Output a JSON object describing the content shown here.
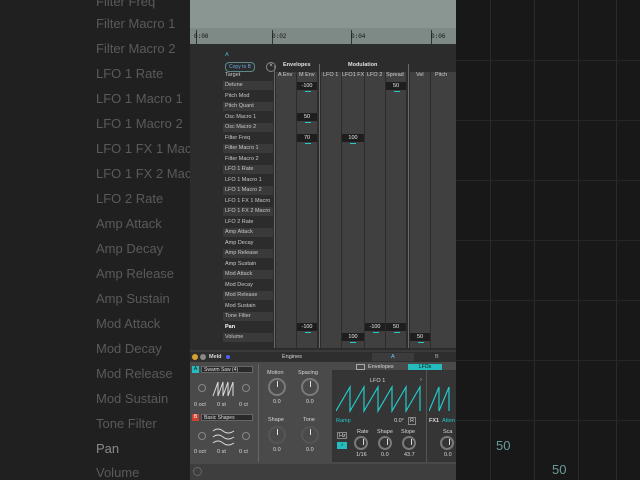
{
  "background_left": {
    "rows": [
      "Filter Freq",
      "Filter Macro 1",
      "Filter Macro 2",
      "LFO 1 Rate",
      "LFO 1 Macro 1",
      "LFO 1 Macro 2",
      "LFO 1 FX 1 Macro",
      "LFO 1 FX 2 Macro",
      "LFO 2 Rate",
      "Amp Attack",
      "Amp Decay",
      "Amp Release",
      "Amp Sustain",
      "Mod Attack",
      "Mod Decay",
      "Mod Release",
      "Mod Sustain",
      "Tone Filter",
      "Pan",
      "Volume"
    ]
  },
  "background_right": {
    "values": [
      "50",
      "50"
    ]
  },
  "timeline": {
    "ticks": [
      "0:00",
      "0:02",
      "0:04",
      "0:06"
    ]
  },
  "matrix": {
    "section": "A",
    "copy_button": "Copy to B",
    "close_icon": "×",
    "target_header": "Target",
    "group_envelopes": "Envelopes",
    "group_modulation": "Modulation",
    "columns": [
      "A Env",
      "M Env",
      "LFO 1",
      "LFO1 FX",
      "LFO 2",
      "Spread",
      "Vel",
      "Pitch"
    ],
    "targets": [
      "Detune",
      "Pitch Mod",
      "Pitch Quant",
      "Osc Macro 1",
      "Osc Macro 2",
      "Filter Freq",
      "Filter Macro 1",
      "Filter Macro 2",
      "LFO 1 Rate",
      "LFO 1 Macro 1",
      "LFO 1 Macro 2",
      "LFO 1 FX 1 Macro",
      "LFO 1 FX 2 Macro",
      "LFO 2 Rate",
      "Amp Attack",
      "Amp Decay",
      "Amp Release",
      "Amp Sustain",
      "Mod Attack",
      "Mod Decay",
      "Mod Release",
      "Mod Sustain",
      "Tone Filter",
      "Pan",
      "Volume"
    ],
    "values": {
      "detune_menv": "-100",
      "detune_spread": "50",
      "oscmacro1_menv": "50",
      "filterfreq_menv": "70",
      "filterfreq_lfo1": "100",
      "pan_menv": "-100",
      "pan_lfo2": "-100",
      "pan_spread": "50",
      "volume_lfo1": "100",
      "volume_vel": "50"
    }
  },
  "device": {
    "name": "Meld",
    "engines_label": "Engines",
    "tab_a": "A",
    "tab_b": "B",
    "osc_a_letter": "A",
    "osc_a_type": "Swarm Saw (4)",
    "osc_b_letter": "B",
    "osc_b_type": "Basic Shapes",
    "oct_a": [
      "0 oct",
      "0 st",
      "0 ct"
    ],
    "oct_b": [
      "0 oct",
      "0 st",
      "0 ct"
    ],
    "motion_label": "Motion",
    "motion_value": "0.0",
    "spacing_label": "Spacing",
    "spacing_value": "0.0",
    "shape_label": "Shape",
    "shape_value": "0.0",
    "tone_label": "Tone",
    "tone_value": "0.0",
    "envelopes_tab": "Envelopes",
    "lfos_tab": "LFOs",
    "lfo_name": "LFO 1",
    "lfo_shape": "Ramp",
    "lfo_phase": "0.0°",
    "hz_label": "Hz",
    "rate_label": "Rate",
    "rate_value": "1/16",
    "lfo_shape_label": "Shape",
    "lfo_shape_value": "0.0",
    "slope_label": "Slope",
    "slope_value": "43.7",
    "fx_label": "FX1",
    "fx_attn": "Atten",
    "scale_label": "Sca",
    "scale_value": "0.0"
  },
  "colors": {
    "accent": "#24c8c8",
    "panel": "#3a3a3a",
    "timeline": "#8a9692"
  }
}
